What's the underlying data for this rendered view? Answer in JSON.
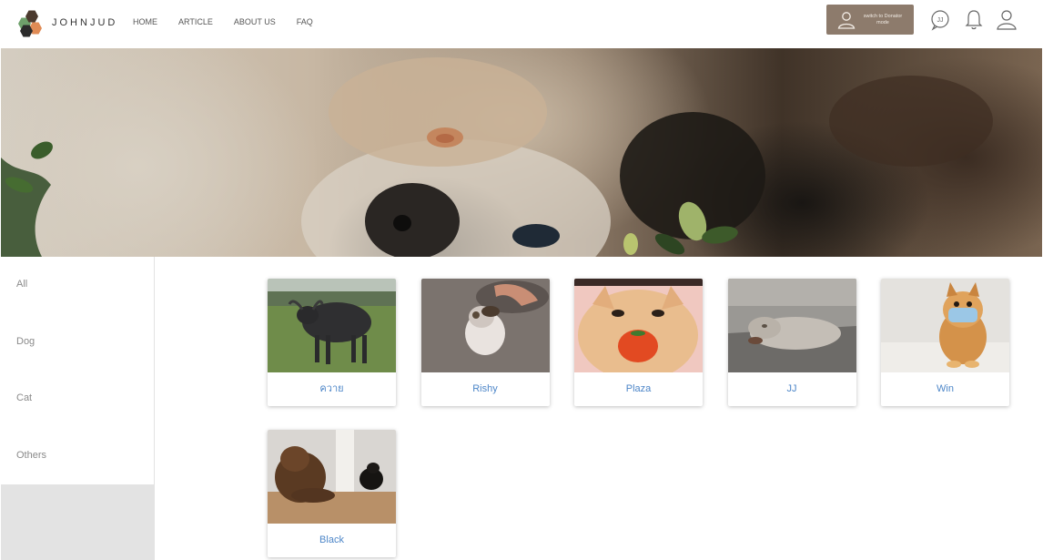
{
  "brand": {
    "name": "JOHNJUD"
  },
  "nav": {
    "items": [
      "HOME",
      "ARTICLE",
      "ABOUT US",
      "FAQ"
    ]
  },
  "header": {
    "switch_label": "switch to Donator mode",
    "chat_icon_text": "JJ",
    "icons": [
      "user-icon",
      "chat-bubble-icon",
      "bell-icon",
      "profile-icon"
    ]
  },
  "sidebar": {
    "items": [
      "All",
      "Dog",
      "Cat",
      "Others"
    ]
  },
  "pets": [
    {
      "name": "ควาย",
      "image": "water-buffalo-photo"
    },
    {
      "name": "Rishy",
      "image": "kitten-photo"
    },
    {
      "name": "Plaza",
      "image": "orange-cat-photo"
    },
    {
      "name": "JJ",
      "image": "grey-cat-photo"
    },
    {
      "name": "Win",
      "image": "pomeranian-with-mask-photo"
    },
    {
      "name": "Black",
      "image": "brown-poodle-photo"
    }
  ],
  "colors": {
    "accent": "#8d7b6c",
    "link": "#4d86c8",
    "sidebar_bg": "#e3e3e3"
  }
}
